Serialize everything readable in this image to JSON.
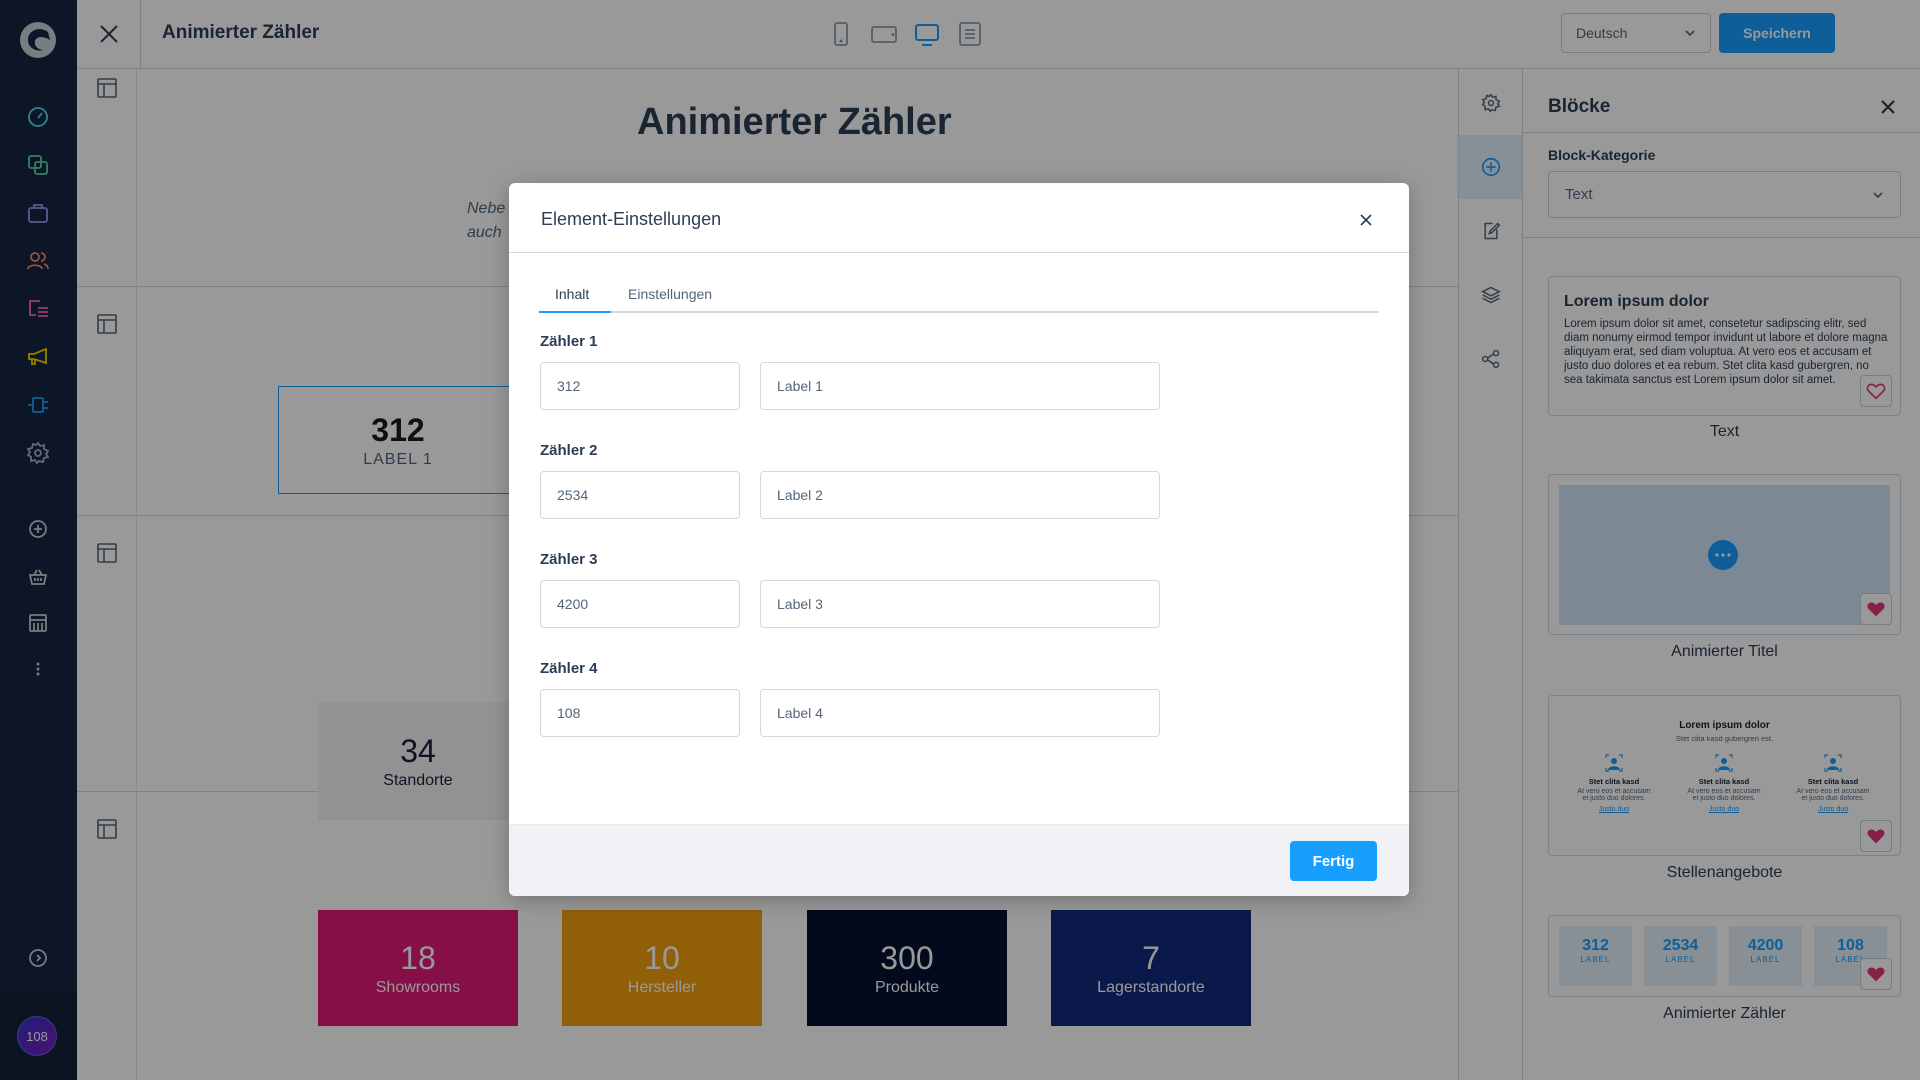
{
  "app": {
    "sidebar": {
      "items": [
        {
          "name": "dashboard",
          "color": "#57d9f4"
        },
        {
          "name": "catalogues",
          "color": "#57d9a3"
        },
        {
          "name": "orders",
          "color": "#a092f0"
        },
        {
          "name": "customers",
          "color": "#f88962"
        },
        {
          "name": "content",
          "color": "#ff68b4"
        },
        {
          "name": "marketing",
          "color": "#ffd700"
        },
        {
          "name": "extensions",
          "color": "#189eff"
        },
        {
          "name": "settings",
          "color": "#a2b3c3"
        }
      ],
      "secondary": [
        {
          "name": "add"
        },
        {
          "name": "sales-channel-storefront"
        },
        {
          "name": "sales-channel-store"
        },
        {
          "name": "more"
        }
      ],
      "avatar_initials": "108"
    }
  },
  "topbar": {
    "title": "Animierter Zähler",
    "devices": [
      "mobile",
      "tablet-landscape",
      "desktop",
      "list"
    ],
    "active_device": "desktop",
    "language": "Deutsch",
    "save_label": "Speichern"
  },
  "canvas": {
    "heading": "Animierter Zähler",
    "text_line1": "Nebe",
    "text_line2": "auch",
    "section2_counter": {
      "value": "312",
      "label": "LABEL 1"
    },
    "section3_counter": {
      "value": "34",
      "label": "Standorte"
    },
    "section4_counters": [
      {
        "value": "18",
        "label": "Showrooms",
        "color": "#e11977"
      },
      {
        "value": "10",
        "label": "Hersteller",
        "color": "#f49f0f"
      },
      {
        "value": "300",
        "label": "Produkte",
        "color": "#081131"
      },
      {
        "value": "7",
        "label": "Lagerstandorte",
        "color": "#122a7a"
      }
    ]
  },
  "right_panel": {
    "title": "Blöcke",
    "category_label": "Block-Kategorie",
    "category_value": "Text",
    "blocks": [
      {
        "name": "Text",
        "preview_title": "Lorem ipsum dolor",
        "preview_text": "Lorem ipsum dolor sit amet, consetetur sadipscing elitr, sed diam nonumy eirmod tempor invidunt ut labore et dolore magna aliquyam erat, sed diam voluptua. At vero eos et accusam et justo duo dolores et ea rebum. Stet clita kasd gubergren, no sea takimata sanctus est Lorem ipsum dolor sit amet.",
        "favorite": false
      },
      {
        "name": "Animierter Titel",
        "favorite": true
      },
      {
        "name": "Stellenangebote",
        "preview_title": "Lorem ipsum dolor",
        "preview_subtitle": "Stet clita kasd gubergren est.",
        "columns": [
          {
            "title": "Stet clita kasd",
            "text1": "At vero eos et accusam",
            "text2": "et justo duo dolores.",
            "link": "Justo duo"
          },
          {
            "title": "Stet clita kasd",
            "text1": "At vero eos et accusam",
            "text2": "et justo duo dolores.",
            "link": "Justo duo"
          },
          {
            "title": "Stet clita kasd",
            "text1": "At vero eos et accusam",
            "text2": "et justo duo dolores.",
            "link": "Justo duo"
          }
        ],
        "favorite": true
      },
      {
        "name": "Animierter Zähler",
        "counters": [
          {
            "value": "312",
            "label": "LABEL"
          },
          {
            "value": "2534",
            "label": "LABEL"
          },
          {
            "value": "4200",
            "label": "LABEL"
          },
          {
            "value": "108",
            "label": "LABEL"
          }
        ],
        "favorite": true
      }
    ]
  },
  "modal": {
    "title": "Element-Einstellungen",
    "tabs": [
      {
        "label": "Inhalt",
        "active": true
      },
      {
        "label": "Einstellungen",
        "active": false
      }
    ],
    "fields": [
      {
        "label": "Zähler 1",
        "value": "312",
        "label_value": "Label 1"
      },
      {
        "label": "Zähler 2",
        "value": "2534",
        "label_value": "Label 2"
      },
      {
        "label": "Zähler 3",
        "value": "4200",
        "label_value": "Label 3"
      },
      {
        "label": "Zähler 4",
        "value": "108",
        "label_value": "Label 4"
      }
    ],
    "done_label": "Fertig"
  },
  "colors": {
    "accent": "#189eff",
    "sidebar_bg": "#172640",
    "favorite": "#e3347b"
  }
}
